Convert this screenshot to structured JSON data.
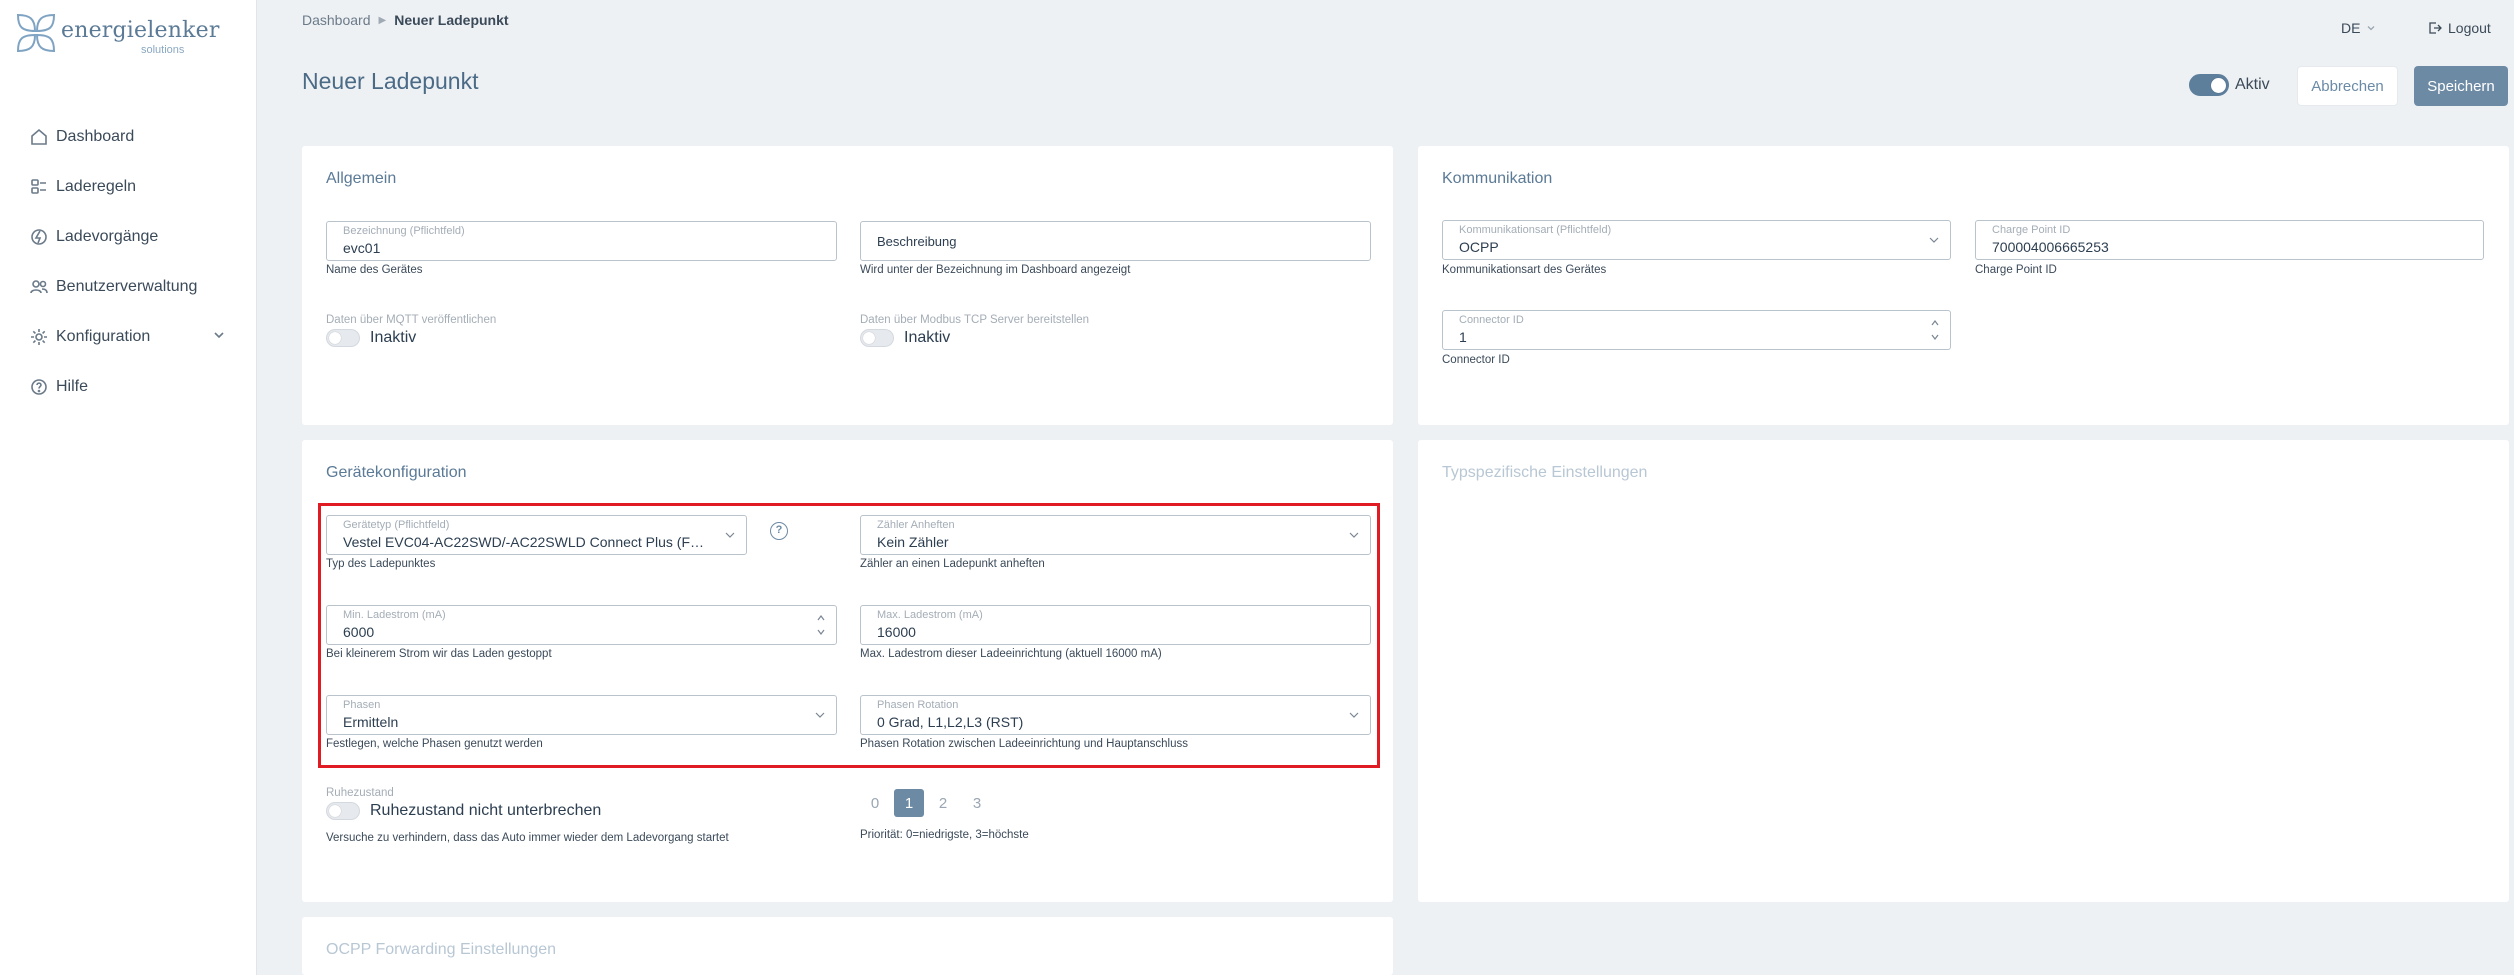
{
  "brand": {
    "name": "energielenker",
    "sub": "solutions"
  },
  "sidebar": {
    "items": [
      {
        "label": "Dashboard",
        "icon": "home-icon"
      },
      {
        "label": "Laderegeln",
        "icon": "rules-icon"
      },
      {
        "label": "Ladevorgänge",
        "icon": "charging-icon"
      },
      {
        "label": "Benutzerverwaltung",
        "icon": "users-icon"
      },
      {
        "label": "Konfiguration",
        "icon": "gear-icon"
      },
      {
        "label": "Hilfe",
        "icon": "help-icon"
      }
    ]
  },
  "header": {
    "breadcrumb": [
      "Dashboard",
      "Neuer Ladepunkt"
    ],
    "language": "DE",
    "logout": "Logout",
    "title": "Neuer Ladepunkt",
    "active_label": "Aktiv",
    "cancel": "Abbrechen",
    "save": "Speichern"
  },
  "allgemein": {
    "title": "Allgemein",
    "name_label": "Bezeichnung (Pflichtfeld)",
    "name_value": "evc01",
    "name_hint": "Name des Gerätes",
    "desc_placeholder": "Beschreibung",
    "desc_hint": "Wird unter der Bezeichnung im Dashboard angezeigt",
    "mqtt_label": "Daten über MQTT veröffentlichen",
    "mqtt_state": "Inaktiv",
    "modbus_label": "Daten über Modbus TCP Server bereitstellen",
    "modbus_state": "Inaktiv"
  },
  "kommunikation": {
    "title": "Kommunikation",
    "type_label": "Kommunikationsart (Pflichtfeld)",
    "type_value": "OCPP",
    "type_hint": "Kommunikationsart des Gerätes",
    "cpid_label": "Charge Point ID",
    "cpid_value": "700004006665253",
    "cpid_hint": "Charge Point ID",
    "connector_label": "Connector ID",
    "connector_value": "1",
    "connector_hint": "Connector ID"
  },
  "geraet": {
    "title": "Gerätekonfiguration",
    "type_label": "Gerätetyp (Pflichtfeld)",
    "type_value": "Vestel EVC04-AC22SWD/-AC22SWLD Connect Plus (FW:...",
    "type_hint": "Typ des Ladepunktes",
    "meter_label": "Zähler Anheften",
    "meter_value": "Kein Zähler",
    "meter_hint": "Zähler an einen Ladepunkt anheften",
    "min_label": "Min. Ladestrom (mA)",
    "min_value": "6000",
    "min_hint": "Bei kleinerem Strom wir das Laden gestoppt",
    "max_label": "Max. Ladestrom (mA)",
    "max_value": "16000",
    "max_hint": "Max. Ladestrom dieser Ladeeinrichtung (aktuell 16000 mA)",
    "phase_label": "Phasen",
    "phase_value": "Ermitteln",
    "phase_hint": "Festlegen, welche Phasen genutzt werden",
    "rot_label": "Phasen Rotation",
    "rot_value": "0 Grad, L1,L2,L3 (RST)",
    "rot_hint": "Phasen Rotation zwischen Ladeeinrichtung und Hauptanschluss",
    "rest_label": "Ruhezustand",
    "rest_text": "Ruhezustand nicht unterbrechen",
    "rest_hint": "Versuche zu verhindern, dass das Auto immer wieder dem Ladevorgang startet",
    "priority": [
      "0",
      "1",
      "2",
      "3"
    ],
    "priority_selected": 1,
    "priority_hint": "Priorität: 0=niedrigste, 3=höchste"
  },
  "typspezifisch": {
    "title": "Typspezifische Einstellungen"
  },
  "ocpp_forward": {
    "title": "OCPP Forwarding Einstellungen"
  },
  "colors": {
    "accent": "#6d8aa4",
    "highlight": "#e01b24"
  }
}
